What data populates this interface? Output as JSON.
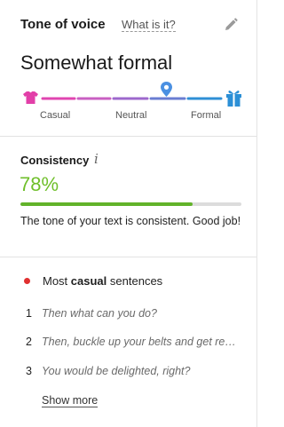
{
  "tone": {
    "title": "Tone of voice",
    "what_is_it": "What is it?",
    "value": "Somewhat formal",
    "scale_labels": {
      "casual": "Casual",
      "neutral": "Neutral",
      "formal": "Formal"
    },
    "marker_position": 0.65,
    "icons": {
      "left": "tshirt-icon",
      "right": "gift-icon",
      "marker": "location-pin-icon",
      "edit": "pencil-icon"
    },
    "colors": {
      "casual_end": "#e23fa8",
      "neutral": "#9b59c9",
      "formal_end": "#2b8fd6",
      "marker": "#4a90e2"
    }
  },
  "consistency": {
    "title": "Consistency",
    "info_glyph": "i",
    "percent": "78%",
    "percent_value": 0.78,
    "message": "The tone of your text is consistent. Good job!",
    "color": "#62b32a"
  },
  "sentences": {
    "header_prefix": "Most",
    "header_bold": "casual",
    "header_suffix": "sentences",
    "items": [
      {
        "num": "1",
        "text": "Then what can you do?"
      },
      {
        "num": "2",
        "text": "Then, buckle up your belts and get ready to travel!"
      },
      {
        "num": "3",
        "text": "You would be delighted, right?"
      }
    ],
    "show_more": "Show more",
    "dot_color": "#e03030"
  }
}
